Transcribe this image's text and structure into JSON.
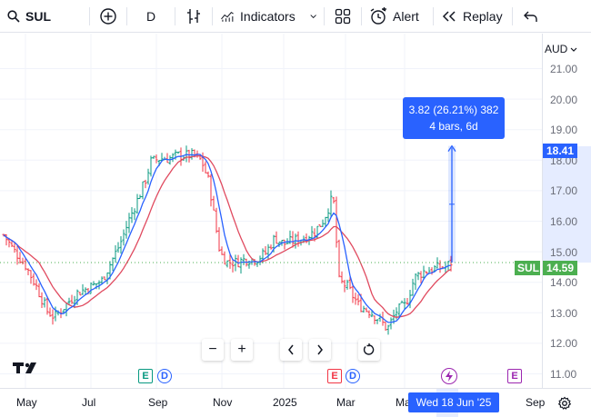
{
  "toolbar": {
    "symbol": "SUL",
    "interval": "D",
    "indicators_label": "Indicators",
    "alert_label": "Alert",
    "replay_label": "Replay"
  },
  "price_axis": {
    "currency": "AUD",
    "ticks": [
      "21.00",
      "20.00",
      "19.00",
      "18.00",
      "17.00",
      "16.00",
      "15.00",
      "14.00",
      "13.00",
      "12.00",
      "11.00"
    ],
    "target_price": "18.41",
    "last_price": "14.59"
  },
  "time_axis": {
    "ticks": [
      "May",
      "Jul",
      "Sep",
      "Nov",
      "2025",
      "Mar",
      "Ma",
      "Sep"
    ],
    "crosshair_date": "Wed 18 Jun '25"
  },
  "symbol_label": "SUL",
  "measure": {
    "line1": "3.82 (26.21%) 382",
    "line2": "4 bars, 6d"
  },
  "events": [
    "E",
    "D",
    "E",
    "D",
    "E"
  ],
  "colors": {
    "up": "#089981",
    "down": "#f23645",
    "ma_fast": "#2962ff",
    "ma_slow": "#e04a5f",
    "accent": "#2962ff",
    "symbol_tag": "#4caf50"
  }
}
